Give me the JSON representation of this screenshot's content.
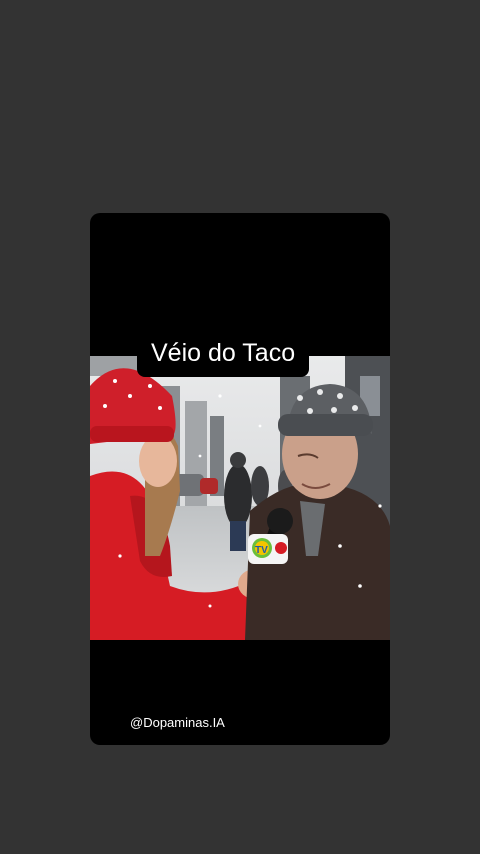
{
  "post": {
    "title": "Véio do Taco",
    "handle": "@Dopaminas.IA",
    "mic_flag_text": "TV"
  },
  "colors": {
    "page_background": "#333333",
    "card_background": "#000000",
    "caption_text": "#ffffff",
    "coat_red": "#d61c24",
    "hat_gray": "#5c5f63"
  },
  "video": {
    "scene_description_icon": "street-interview-image"
  }
}
